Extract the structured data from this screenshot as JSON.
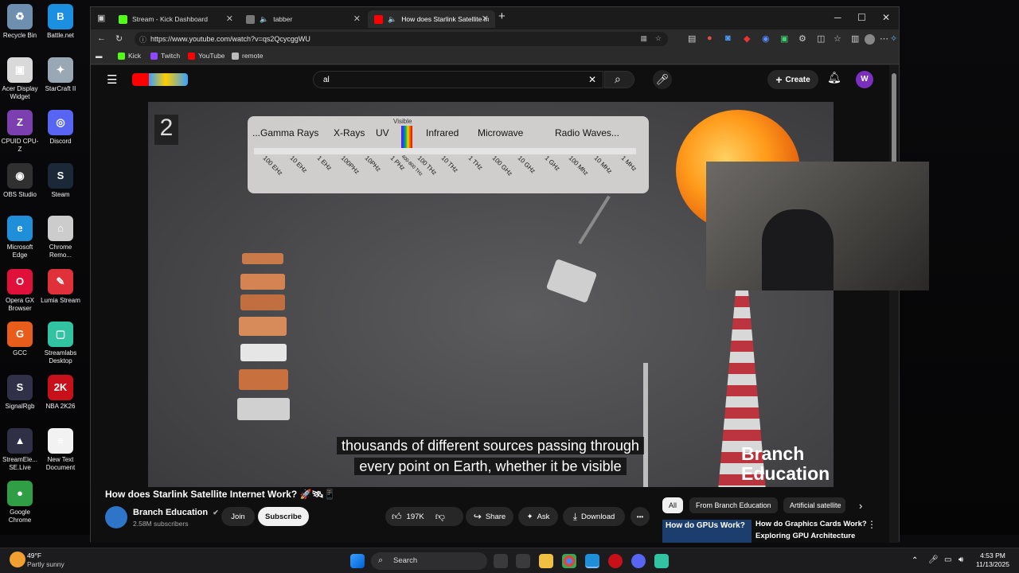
{
  "desktop": {
    "icons": [
      {
        "label": "Recycle Bin",
        "color": "#6f8fb0",
        "glyph": "♻"
      },
      {
        "label": "Battle.net",
        "color": "#1b8fe0",
        "glyph": "B"
      },
      {
        "label": "Acer Display Widget",
        "color": "#d9d9d9",
        "glyph": "▣"
      },
      {
        "label": "StarCraft II",
        "color": "#9aa7b5",
        "glyph": "✦"
      },
      {
        "label": "CPUID CPU-Z",
        "color": "#7b3fb0",
        "glyph": "Z"
      },
      {
        "label": "Discord",
        "color": "#5865f2",
        "glyph": "◎"
      },
      {
        "label": "OBS Studio",
        "color": "#303030",
        "glyph": "◉"
      },
      {
        "label": "Steam",
        "color": "#1b2838",
        "glyph": "S"
      },
      {
        "label": "Microsoft Edge",
        "color": "#1e8fd8",
        "glyph": "e"
      },
      {
        "label": "Chrome Remo...",
        "color": "#cccccc",
        "glyph": "⌂"
      },
      {
        "label": "Opera GX Browser",
        "color": "#e0103a",
        "glyph": "O"
      },
      {
        "label": "Lumia Stream",
        "color": "#e0303a",
        "glyph": "✎"
      },
      {
        "label": "GCC",
        "color": "#e85d1a",
        "glyph": "G"
      },
      {
        "label": "Streamlabs Desktop",
        "color": "#31c3a2",
        "glyph": "▢"
      },
      {
        "label": "SignalRgb",
        "color": "#303048",
        "glyph": "S"
      },
      {
        "label": "NBA 2K26",
        "color": "#c8101a",
        "glyph": "2K"
      },
      {
        "label": "StreamEle... SE.Live",
        "color": "#2f2f45",
        "glyph": "▲"
      },
      {
        "label": "New Text Document",
        "color": "#f2f2f2",
        "glyph": "≡"
      },
      {
        "label": "Google Chrome",
        "color": "#2f9e44",
        "glyph": "●"
      }
    ]
  },
  "browser": {
    "tabs": [
      {
        "title": "Stream - Kick Dashboard",
        "color": "#53fc18"
      },
      {
        "title": "tabber",
        "color": "#bbbbbb"
      },
      {
        "title": "How does Starlink Satellite In",
        "color": "#ff0000"
      }
    ],
    "new_tab": "+",
    "window_controls": {
      "minimize": "─",
      "maximize": "☐",
      "close": "✕"
    },
    "url": "https://www.youtube.com/watch?v=qs2QcycggWU",
    "favorites": [
      {
        "label": "Kick",
        "color": "#53fc18"
      },
      {
        "label": "Twitch",
        "color": "#9146ff"
      },
      {
        "label": "YouTube",
        "color": "#ff0000"
      },
      {
        "label": "remote",
        "color": "#bbbbbb"
      }
    ]
  },
  "youtube": {
    "search_value": "al",
    "clear_icon": "✕",
    "create_label": "Create",
    "avatar_letter": "W",
    "video": {
      "badge": "2",
      "visible_label": "Visible",
      "bands": [
        "...Gamma Rays",
        "X-Rays",
        "UV",
        "Infrared",
        "Microwave",
        "Radio Waves..."
      ],
      "ticks": [
        "100 EHz",
        "10 EHz",
        "1 EHz",
        "100PHz",
        "10PHz",
        "1 PHz",
        "400-800 THz",
        "100 THz",
        "10 THz",
        "1 THz",
        "100 GHz",
        "10 GHz",
        "1 GHz",
        "100 Mhz",
        "10 MHz",
        "1 MHz"
      ],
      "caption_line1": "thousands of different sources passing through",
      "caption_line2": "every point on Earth, whether it be visible",
      "watermark_line1": "Branch",
      "watermark_line2": "Education"
    },
    "title": "How does Starlink Satellite Internet Work? 🚀🛰📱",
    "channel": {
      "name": "Branch Education",
      "subscribers": "2.58M subscribers",
      "verified": "✔"
    },
    "join_label": "Join",
    "subscribe_label": "Subscribe",
    "likes": "197K",
    "share_label": "Share",
    "ask_label": "Ask",
    "download_label": "Download",
    "more": "•••",
    "chips": [
      "All",
      "From Branch Education",
      "Artificial satellite"
    ],
    "rec": {
      "thumb_text": "How do GPUs Work?",
      "title": "How do Graphics Cards Work?",
      "subtitle": "Exploring GPU Architecture"
    }
  },
  "taskbar": {
    "weather_temp": "49°F",
    "weather_desc": "Partly sunny",
    "search_label": "Search",
    "time": "4:53 PM",
    "date": "11/13/2025"
  }
}
